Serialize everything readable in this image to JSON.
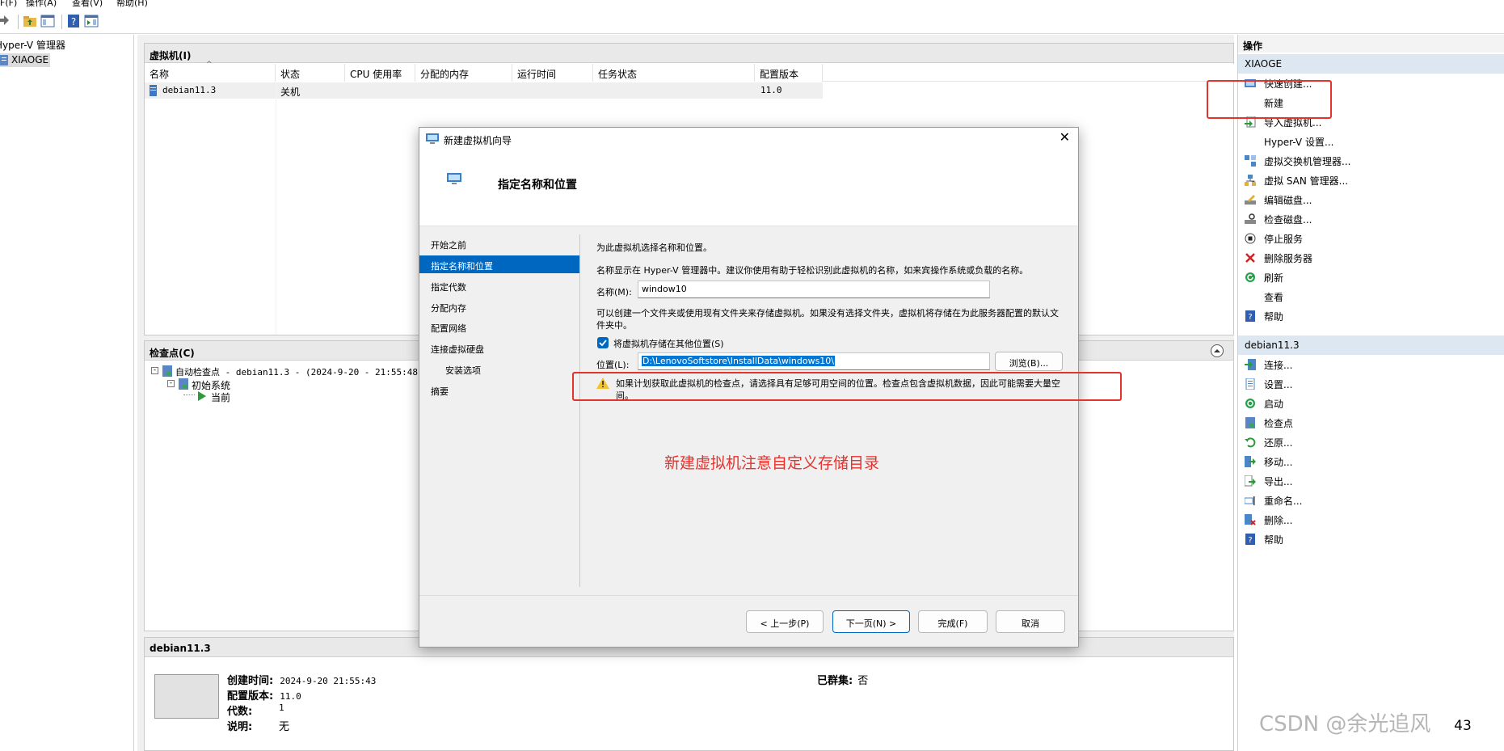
{
  "menu": {
    "file": "F(F)",
    "action": "操作(A)",
    "view": "查看(V)",
    "help": "帮助(H)"
  },
  "tree": {
    "root": "Hyper-V 管理器",
    "server": "XIAOGE"
  },
  "vm_pane": {
    "title": "虚拟机(I)",
    "columns": [
      "名称",
      "状态",
      "CPU 使用率",
      "分配的内存",
      "运行时间",
      "任务状态",
      "配置版本"
    ],
    "rows": [
      {
        "name": "debian11.3",
        "state": "关机",
        "cpu": "",
        "memory": "",
        "uptime": "",
        "task": "",
        "version": "11.0"
      }
    ]
  },
  "checkpoint_pane": {
    "title": "检查点(C)",
    "items": [
      "自动检查点 - debian11.3 - (2024-9-20 - 21:55:48)",
      "初始系统",
      "当前"
    ]
  },
  "details_pane": {
    "title": "debian11.3",
    "fields": [
      {
        "label": "创建时间:",
        "value": "2024-9-20 21:55:43"
      },
      {
        "label": "配置版本:",
        "value": "11.0"
      },
      {
        "label": "代数:",
        "value": "1"
      },
      {
        "label": "说明:",
        "value": "无"
      }
    ],
    "clustered_label": "已群集:",
    "clustered_value": "否"
  },
  "actions": {
    "header": "操作",
    "group1": "XIAOGE",
    "group1_items": [
      "快速创建...",
      "新建",
      "导入虚拟机...",
      "Hyper-V 设置...",
      "虚拟交换机管理器...",
      "虚拟 SAN 管理器...",
      "编辑磁盘...",
      "检查磁盘...",
      "停止服务",
      "删除服务器",
      "刷新",
      "查看",
      "帮助"
    ],
    "group2": "debian11.3",
    "group2_items": [
      "连接...",
      "设置...",
      "启动",
      "检查点",
      "还原...",
      "移动...",
      "导出...",
      "重命名...",
      "删除...",
      "帮助"
    ]
  },
  "wizard": {
    "title": "新建虚拟机向导",
    "heading": "指定名称和位置",
    "steps": [
      "开始之前",
      "指定名称和位置",
      "指定代数",
      "分配内存",
      "配置网络",
      "连接虚拟硬盘",
      "安装选项",
      "摘要"
    ],
    "intro": "为此虚拟机选择名称和位置。",
    "name_desc": "名称显示在 Hyper-V 管理器中。建议你使用有助于轻松识别此虚拟机的名称，如来宾操作系统或负载的名称。",
    "name_label": "名称(M):",
    "name_value": "window10",
    "folder_desc_1": "可以创建一个文件夹或使用现有文件夹来存储虚拟机。如果没有选择文件夹，虚拟机将存储在为此服务器配置的默认文",
    "folder_desc_2": "件夹中。",
    "checkbox_label": "将虚拟机存储在其他位置(S)",
    "location_label": "位置(L):",
    "location_value": "D:\\LenovoSoftstore\\InstallData\\windows10\\",
    "browse": "浏览(B)...",
    "warning_1": "如果计划获取此虚拟机的检查点，请选择具有足够可用空间的位置。检查点包含虚拟机数据，因此可能需要大量空",
    "warning_2": "间。",
    "annotation": "新建虚拟机注意自定义存储目录",
    "annotation_color": "#e5322d",
    "buttons": {
      "prev": "< 上一步(P)",
      "next": "下一页(N) >",
      "finish": "完成(F)",
      "cancel": "取消"
    }
  },
  "watermark": "CSDN @余光追风",
  "badge": "43"
}
